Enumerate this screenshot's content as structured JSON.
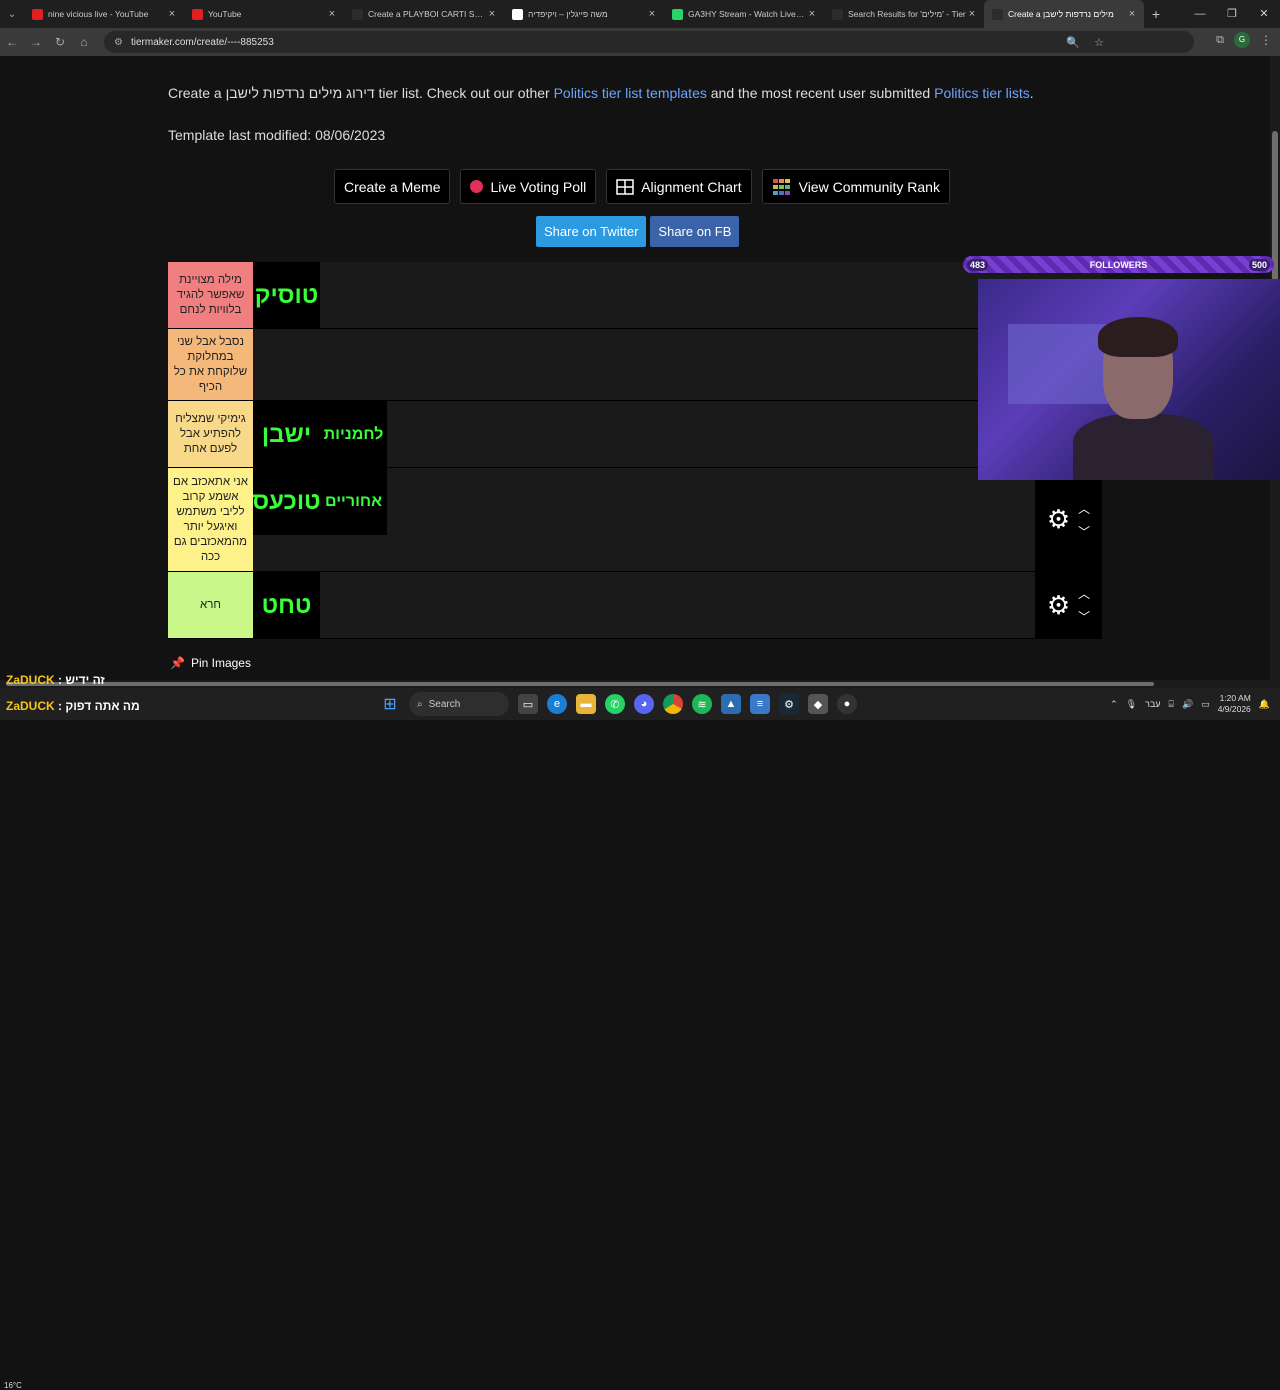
{
  "tabs": [
    {
      "title": "nine vicious live - YouTube",
      "favicon_color": "#e02020",
      "active": false
    },
    {
      "title": "YouTube",
      "favicon_color": "#e02020",
      "active": false
    },
    {
      "title": "Create a PLAYBOI CARTI SONG",
      "favicon_color": "#2c2c2c",
      "active": false
    },
    {
      "title": "משה פייגלין – ויקיפדיה",
      "favicon_color": "#ffffff",
      "active": false
    },
    {
      "title": "GA3HY Stream - Watch Live on",
      "favicon_color": "#2bd46a",
      "active": false
    },
    {
      "title": "Search Results for 'מילים' - Tier",
      "favicon_color": "#2c2c2c",
      "active": false
    },
    {
      "title": "Create a מילים נרדפות לישבן",
      "favicon_color": "#2c2c2c",
      "active": true
    }
  ],
  "url": "tiermaker.com/create/----885253",
  "description": {
    "prefix": "Create a דירוג מילים נרדפות לישבן tier list. Check out our other ",
    "link1": "Politics tier list templates",
    "middle": " and the most recent user submitted ",
    "link2": "Politics tier lists",
    "suffix": "."
  },
  "modified": "Template last modified: 08/06/2023",
  "buttons": {
    "meme": "Create a Meme",
    "poll": "Live Voting Poll",
    "alignment": "Alignment Chart",
    "community": "View Community Rank"
  },
  "share": {
    "twitter": "Share on Twitter",
    "fb": "Share on FB"
  },
  "tiers": [
    {
      "label": "מילה מצויינת שאפשר להגיד בלוויות לנחם",
      "color": "#f08080",
      "items": [
        "טוסיק"
      ],
      "controls": false
    },
    {
      "label": "נסבל אבל שני במחלוקת שלוקחת את כל הכיף",
      "color": "#f4b97a",
      "items": [],
      "controls": false
    },
    {
      "label": "גימיקי שמצליח להפתיע אבל לפעם אחת",
      "color": "#f8d98a",
      "items": [
        "ישבן",
        "לחמניות"
      ],
      "controls": false
    },
    {
      "label": "אני אתאכזב אם אשמע קרוב לליבי משתמש ואיגעל יותר מהמאכזבים גם ככה",
      "color": "#fdf28a",
      "items": [
        "טוכעס",
        "אחוריים"
      ],
      "controls": true
    },
    {
      "label": "חרא",
      "color": "#c9f78a",
      "items": [
        "טחט"
      ],
      "controls": true
    }
  ],
  "pin_images": "Pin Images",
  "overlay": {
    "followers_label": "FOLLOWERS",
    "followers_current": "483",
    "followers_goal": "500"
  },
  "chat": [
    {
      "name": "ZaDUCK",
      "message": "זה ידיש"
    },
    {
      "name": "ZaDUCK",
      "message": "מה אתה דפוק"
    }
  ],
  "taskbar": {
    "search": "Search",
    "lang": "עבר",
    "time": "1:20 AM",
    "date": "4/9/2026",
    "weather": "16°C"
  }
}
